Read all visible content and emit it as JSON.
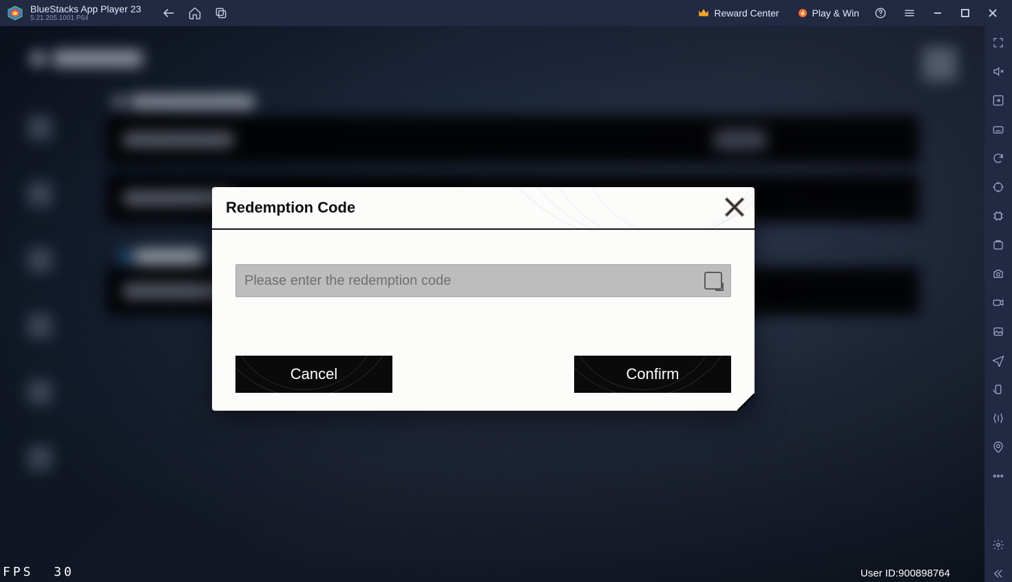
{
  "titlebar": {
    "app_name": "BlueStacks App Player 23",
    "version": "5.21.205.1001  P64",
    "reward_center": "Reward Center",
    "play_win": "Play & Win"
  },
  "modal": {
    "title": "Redemption Code",
    "placeholder": "Please enter the redemption code",
    "cancel": "Cancel",
    "confirm": "Confirm"
  },
  "footer": {
    "fps_label": "FPS",
    "fps_value": "30",
    "user_id_label": "User ID:",
    "user_id_value": "900898764"
  }
}
